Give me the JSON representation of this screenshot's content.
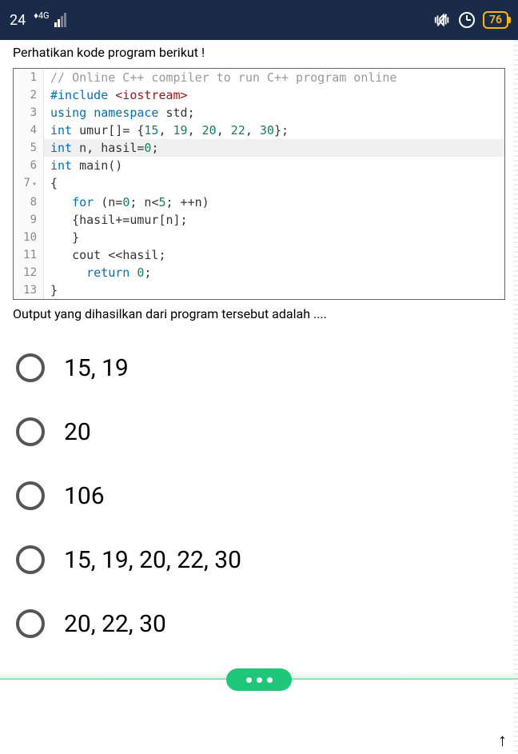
{
  "status": {
    "time_fragment": "24",
    "network_label": "4G",
    "battery": "76"
  },
  "question": {
    "prompt": "Perhatikan kode program berikut !",
    "followup": "Output yang dihasilkan dari program tersebut adalah ...."
  },
  "code": {
    "lines": [
      {
        "n": "1",
        "tokens": [
          {
            "cls": "c-comment",
            "t": "// Online C++ compiler to run C++ program online"
          }
        ]
      },
      {
        "n": "2",
        "tokens": [
          {
            "cls": "c-keyword",
            "t": "#include "
          },
          {
            "cls": "c-include",
            "t": "<iostream>"
          }
        ]
      },
      {
        "n": "3",
        "tokens": [
          {
            "cls": "c-keyword",
            "t": "using "
          },
          {
            "cls": "c-keyword",
            "t": "namespace "
          },
          {
            "cls": "c-ident",
            "t": "std"
          },
          {
            "cls": "c-punc",
            "t": ";"
          }
        ]
      },
      {
        "n": "4",
        "tokens": [
          {
            "cls": "c-type",
            "t": "int "
          },
          {
            "cls": "c-ident",
            "t": "umur[]"
          },
          {
            "cls": "c-punc",
            "t": "= {"
          },
          {
            "cls": "c-num",
            "t": "15"
          },
          {
            "cls": "c-punc",
            "t": ", "
          },
          {
            "cls": "c-num",
            "t": "19"
          },
          {
            "cls": "c-punc",
            "t": ", "
          },
          {
            "cls": "c-num",
            "t": "20"
          },
          {
            "cls": "c-punc",
            "t": ", "
          },
          {
            "cls": "c-num",
            "t": "22"
          },
          {
            "cls": "c-punc",
            "t": ", "
          },
          {
            "cls": "c-num",
            "t": "30"
          },
          {
            "cls": "c-punc",
            "t": "};"
          }
        ]
      },
      {
        "n": "5",
        "hl": true,
        "tokens": [
          {
            "cls": "c-type",
            "t": "int"
          },
          {
            "cls": "c-ident",
            "t": " n, hasil"
          },
          {
            "cls": "c-punc",
            "t": "="
          },
          {
            "cls": "c-num",
            "t": "0"
          },
          {
            "cls": "c-punc",
            "t": ";"
          }
        ]
      },
      {
        "n": "6",
        "tokens": [
          {
            "cls": "c-type",
            "t": "int "
          },
          {
            "cls": "c-ident",
            "t": "main()"
          }
        ]
      },
      {
        "n": "7",
        "fold": true,
        "tokens": [
          {
            "cls": "c-punc",
            "t": "{"
          }
        ]
      },
      {
        "n": "8",
        "tokens": [
          {
            "cls": "",
            "t": "   "
          },
          {
            "cls": "c-keyword",
            "t": "for "
          },
          {
            "cls": "c-punc",
            "t": "(n"
          },
          {
            "cls": "c-punc",
            "t": "="
          },
          {
            "cls": "c-num",
            "t": "0"
          },
          {
            "cls": "c-punc",
            "t": "; n"
          },
          {
            "cls": "c-punc",
            "t": "<"
          },
          {
            "cls": "c-num",
            "t": "5"
          },
          {
            "cls": "c-punc",
            "t": "; ++n)"
          }
        ]
      },
      {
        "n": "9",
        "tokens": [
          {
            "cls": "",
            "t": "   "
          },
          {
            "cls": "c-punc",
            "t": "{hasil+=umur[n];"
          }
        ]
      },
      {
        "n": "10",
        "tokens": [
          {
            "cls": "",
            "t": "   "
          },
          {
            "cls": "c-punc",
            "t": "}"
          }
        ]
      },
      {
        "n": "11",
        "tokens": [
          {
            "cls": "",
            "t": "   "
          },
          {
            "cls": "c-ident",
            "t": "cout "
          },
          {
            "cls": "c-punc",
            "t": "<<"
          },
          {
            "cls": "c-ident",
            "t": "hasil"
          },
          {
            "cls": "c-punc",
            "t": ";"
          }
        ]
      },
      {
        "n": "12",
        "tokens": [
          {
            "cls": "",
            "t": "     "
          },
          {
            "cls": "c-keyword",
            "t": "return "
          },
          {
            "cls": "c-num",
            "t": "0"
          },
          {
            "cls": "c-punc",
            "t": ";"
          }
        ]
      },
      {
        "n": "13",
        "tokens": [
          {
            "cls": "c-punc",
            "t": "}"
          }
        ]
      }
    ]
  },
  "options": [
    {
      "label": "15, 19"
    },
    {
      "label": "20"
    },
    {
      "label": "106"
    },
    {
      "label": "15, 19, 20, 22, 30"
    },
    {
      "label": "20, 22, 30"
    }
  ]
}
